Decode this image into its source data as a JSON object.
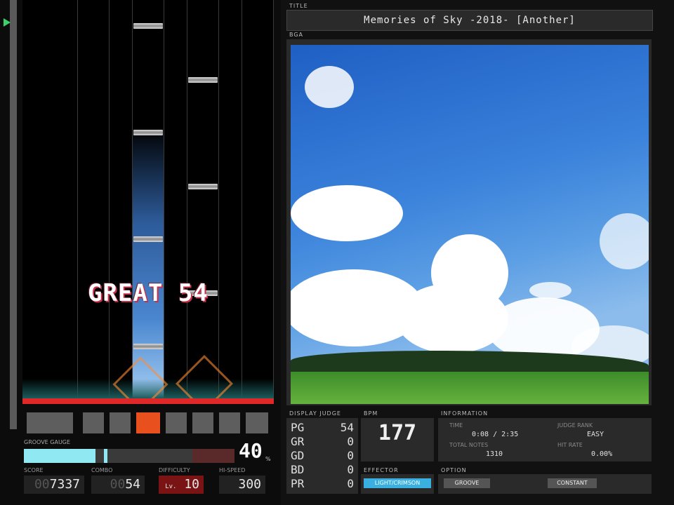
{
  "song": {
    "title_label": "TITLE",
    "title": "Memories of Sky -2018- [Another]",
    "bga_label": "BGA"
  },
  "playfield": {
    "judgement": "GREAT 54"
  },
  "gauge": {
    "label": "GROOVE GAUGE",
    "value": "40",
    "unit": "%",
    "fill_percent": 40
  },
  "stats": {
    "score_label": "SCORE",
    "score_dim": "00",
    "score": "7337",
    "combo_label": "COMBO",
    "combo_dim": "00",
    "combo": "54",
    "difficulty_label": "DIFFICULTY",
    "difficulty_prefix": "Lv.",
    "difficulty": "10",
    "hispeed_label": "HI-SPEED",
    "hispeed": "300"
  },
  "judge_panel": {
    "label": "DISPLAY JUDGE",
    "rows": [
      {
        "name": "PG",
        "count": "54"
      },
      {
        "name": "GR",
        "count": "0"
      },
      {
        "name": "GD",
        "count": "0"
      },
      {
        "name": "BD",
        "count": "0"
      },
      {
        "name": "PR",
        "count": "0"
      }
    ]
  },
  "bpm": {
    "label": "BPM",
    "value": "177"
  },
  "effector": {
    "label": "EFFECTOR",
    "value": "LIGHT/CRIMSON"
  },
  "information": {
    "label": "INFORMATION",
    "time_label": "TIME",
    "time_value": "0:08 / 2:35",
    "judge_rank_label": "JUDGE RANK",
    "judge_rank_value": "EASY",
    "total_notes_label": "TOTAL NOTES",
    "total_notes_value": "1310",
    "hit_rate_label": "HIT RATE",
    "hit_rate_value": "0.00%"
  },
  "option": {
    "label": "OPTION",
    "gauge_option": "GROOVE",
    "speed_option": "CONSTANT"
  },
  "colors": {
    "gauge_fill": "#8fe8f2",
    "judgeline": "#e02828",
    "active_key": "#e8501e",
    "effector": "#3ab0e0"
  }
}
